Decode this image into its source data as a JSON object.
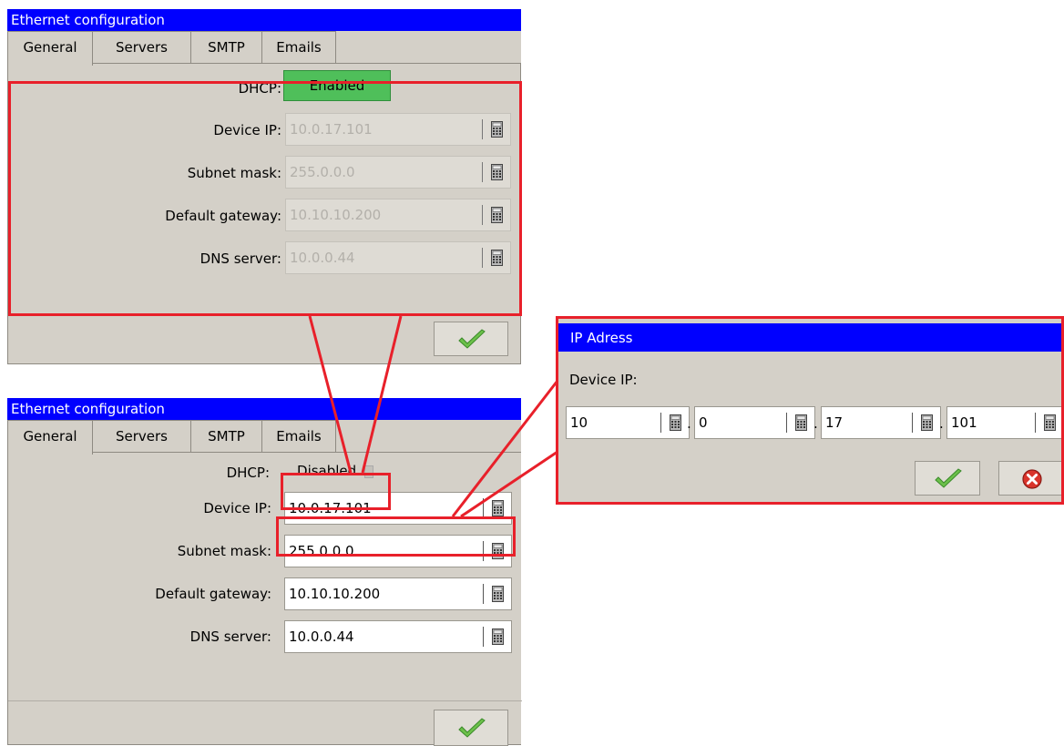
{
  "top_window": {
    "title": "Ethernet configuration",
    "tabs": [
      "General",
      "Servers",
      "SMTP",
      "Emails"
    ],
    "dhcp_label": "DHCP:",
    "dhcp_value": "Enabled",
    "fields": [
      {
        "label": "Device IP:",
        "value": "10.0.17.101"
      },
      {
        "label": "Subnet mask:",
        "value": "255.0.0.0"
      },
      {
        "label": "Default gateway:",
        "value": "10.10.10.200"
      },
      {
        "label": "DNS server:",
        "value": "10.0.0.44"
      }
    ]
  },
  "bottom_window": {
    "title": "Ethernet configuration",
    "tabs": [
      "General",
      "Servers",
      "SMTP",
      "Emails"
    ],
    "dhcp_label": "DHCP:",
    "dhcp_value": "Disabled",
    "fields": [
      {
        "label": "Device IP:",
        "value": "10.0.17.101"
      },
      {
        "label": "Subnet mask:",
        "value": "255.0.0.0"
      },
      {
        "label": "Default gateway:",
        "value": "10.10.10.200"
      },
      {
        "label": "DNS server:",
        "value": "10.0.0.44"
      }
    ]
  },
  "ip_dialog": {
    "title": "IP Adress",
    "label": "Device IP:",
    "octets": [
      "10",
      "0",
      "17",
      "101"
    ],
    "dot": "."
  },
  "icons": {
    "calculator": "calculator-icon",
    "ok": "checkmark-icon",
    "cancel": "cancel-icon"
  },
  "colors": {
    "titlebar": "#0000ff",
    "highlight": "#e8202a",
    "dhcp_enabled": "#4fbf5a",
    "checkmark": "#5cbf3a"
  }
}
